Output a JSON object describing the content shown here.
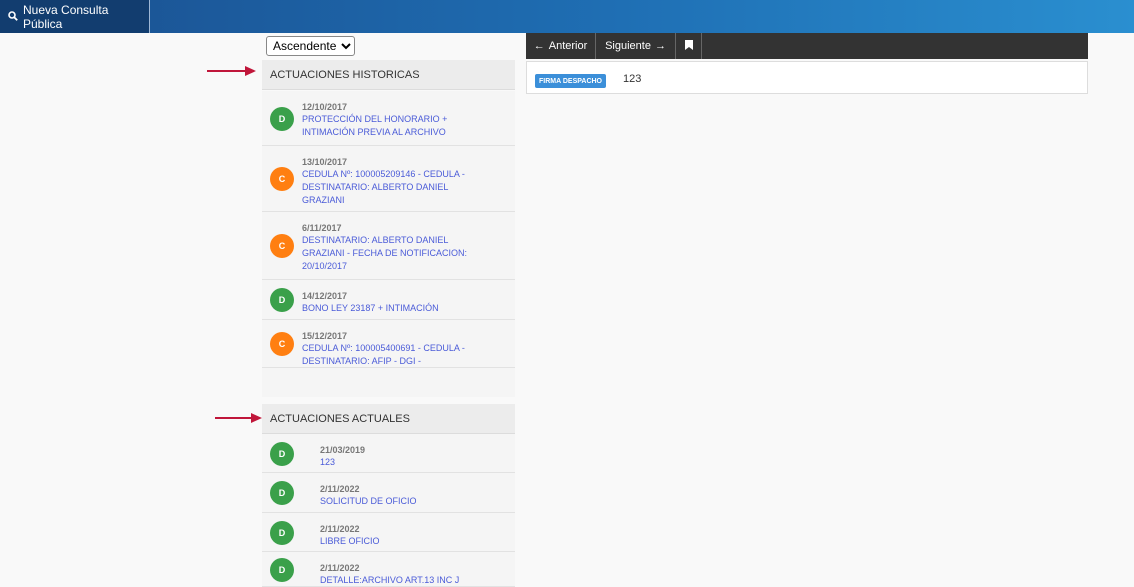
{
  "toolbar": {
    "new_search_label": "Nueva Consulta Pública"
  },
  "sort": {
    "selected": "Ascendente"
  },
  "historicas": {
    "title": "ACTUACIONES HISTORICAS",
    "items": [
      {
        "avatar": "D",
        "color": "#3aa04a",
        "date": "12/10/2017",
        "lines": [
          "PROTECCIÓN DEL HONORARIO +",
          "INTIMACIÓN PREVIA AL ARCHIVO"
        ]
      },
      {
        "avatar": "C",
        "color": "#ff7f11",
        "date": "13/10/2017",
        "lines": [
          "CEDULA Nº: 100005209146 - CEDULA -",
          "DESTINATARIO: ALBERTO DANIEL",
          "GRAZIANI"
        ]
      },
      {
        "avatar": "C",
        "color": "#ff7f11",
        "date": "6/11/2017",
        "lines": [
          "DESTINATARIO: ALBERTO DANIEL",
          "GRAZIANI - FECHA DE NOTIFICACION:",
          "20/10/2017"
        ]
      },
      {
        "avatar": "D",
        "color": "#3aa04a",
        "date": "14/12/2017",
        "lines": [
          "BONO LEY 23187 + INTIMACIÓN"
        ]
      },
      {
        "avatar": "C",
        "color": "#ff7f11",
        "date": "15/12/2017",
        "lines": [
          "CEDULA Nº: 100005400691 - CEDULA -",
          "DESTINATARIO: AFIP - DGI -"
        ]
      }
    ]
  },
  "actuales": {
    "title": "ACTUACIONES ACTUALES",
    "items": [
      {
        "avatar": "D",
        "color": "#3aa04a",
        "date": "21/03/2019",
        "lines": [
          "123"
        ]
      },
      {
        "avatar": "D",
        "color": "#3aa04a",
        "date": "2/11/2022",
        "lines": [
          "SOLICITUD DE OFICIO"
        ]
      },
      {
        "avatar": "D",
        "color": "#3aa04a",
        "date": "2/11/2022",
        "lines": [
          "LIBRE OFICIO"
        ]
      },
      {
        "avatar": "D",
        "color": "#3aa04a",
        "date": "2/11/2022",
        "lines": [
          "DETALLE:ARCHIVO ART.13 INC J"
        ]
      }
    ]
  },
  "pager": {
    "prev_label": "Anterior",
    "next_label": "Siguiente"
  },
  "detail": {
    "badge": "FIRMA DESPACHO",
    "value": "123"
  },
  "colors": {
    "arrow": "#c0163a"
  }
}
